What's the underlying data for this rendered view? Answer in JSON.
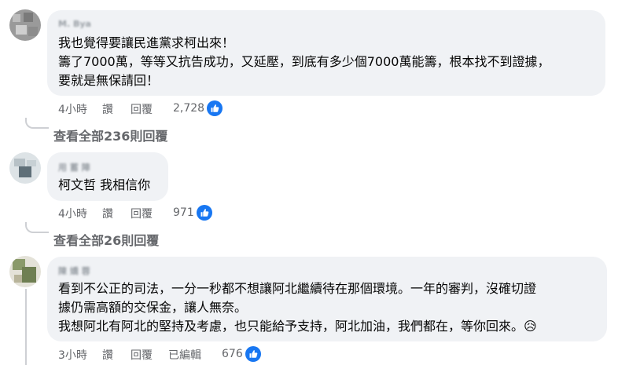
{
  "comments": [
    {
      "author": "M. Bya",
      "lines": [
        "我也覺得要讓民進黨求柯出來！",
        "籌了7000萬，等等又抗告成功，又延壓，到底有多少個7000萬能籌，根本找不到證據，",
        "要就是無保請回！"
      ],
      "time": "4小時",
      "like_label": "讚",
      "reply_label": "回覆",
      "edited_label": "",
      "reaction_count": "2,728",
      "view_replies": "查看全部236則回覆"
    },
    {
      "author": "用 蓄 陣",
      "lines": [
        "柯文哲 我相信你"
      ],
      "time": "4小時",
      "like_label": "讚",
      "reply_label": "回覆",
      "edited_label": "",
      "reaction_count": "971",
      "view_replies": "查看全部26則回覆"
    },
    {
      "author": "陳 嬌 蓉",
      "lines": [
        "看到不公正的司法，一分一秒都不想讓阿北繼續待在那個環境。一年的審判，沒確切證",
        "據仍需高額的交保金，讓人無奈。",
        "我想阿北有阿北的堅持及考慮，也只能給予支持，阿北加油，我們都在，等你回來。😥"
      ],
      "time": "3小時",
      "like_label": "讚",
      "reply_label": "回覆",
      "edited_label": "已編輯",
      "reaction_count": "676",
      "view_replies": ""
    }
  ],
  "colors": {
    "bubble": "#f0f2f5",
    "meta_text": "#65676b",
    "like_blue": "#1877f2",
    "thread_line": "#ced0d4"
  }
}
